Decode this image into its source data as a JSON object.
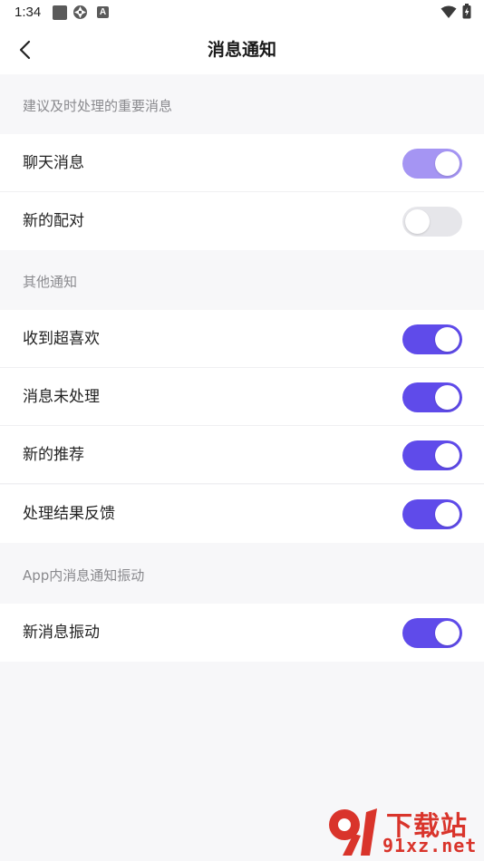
{
  "status_bar": {
    "time": "1:34",
    "icons_left": [
      "square-icon",
      "aperture-icon",
      "app-a-icon"
    ],
    "app_a_letter": "A",
    "icons_right": [
      "wifi-icon",
      "battery-icon"
    ]
  },
  "header": {
    "back_icon": "chevron-left-icon",
    "title": "消息通知"
  },
  "sections": [
    {
      "title": "建议及时处理的重要消息",
      "items": [
        {
          "label": "聊天消息",
          "state": "on-light"
        },
        {
          "label": "新的配对",
          "state": "off"
        }
      ]
    },
    {
      "title": "其他通知",
      "items": [
        {
          "label": "收到超喜欢",
          "state": "on"
        },
        {
          "label": "消息未处理",
          "state": "on"
        },
        {
          "label": "新的推荐",
          "state": "on"
        },
        {
          "label": "处理结果反馈",
          "state": "on"
        }
      ]
    },
    {
      "title": "App内消息通知振动",
      "items": [
        {
          "label": "新消息振动",
          "state": "on"
        }
      ]
    }
  ],
  "colors": {
    "accent": "#5f4bea",
    "accent_light": "#a595f3",
    "toggle_off": "#e6e6ea",
    "page_background": "#f7f7f9",
    "section_title_text": "#8a8a8e"
  },
  "watermark": {
    "line1": "下载站",
    "line2": "91xz.net",
    "logo_icon": "91-logo-icon"
  }
}
